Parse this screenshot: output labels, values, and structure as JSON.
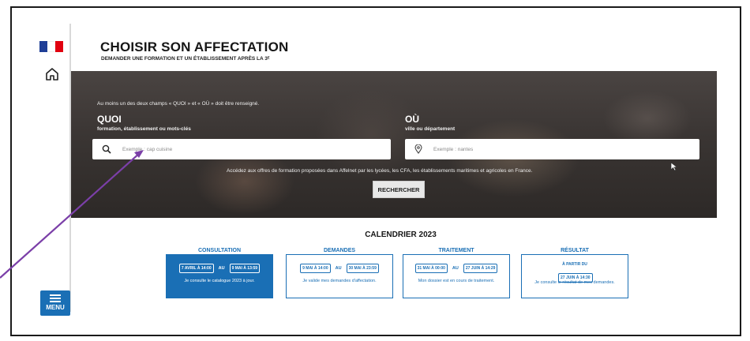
{
  "header": {
    "title": "CHOISIR SON AFFECTATION",
    "subtitle": "DEMANDER UNE FORMATION ET UN ÉTABLISSEMENT APRÈS LA 3ᴱ"
  },
  "sidebar": {
    "menu_label": "MENU"
  },
  "search": {
    "note": "Au moins un des deux champs « QUOI » et « OÙ » doit être renseigné.",
    "quoi_label": "QUOI",
    "quoi_sub": "formation, établissement ou mots-clés",
    "quoi_placeholder": "Exemple : cap cuisine",
    "ou_label": "OÙ",
    "ou_sub": "ville ou département",
    "ou_placeholder": "Exemple : nantes",
    "info": "Accédez aux offres de formation proposées dans Affelnet par les lycées, les CFA, les établissements maritimes et agricoles en France.",
    "button": "RECHERCHER"
  },
  "calendar": {
    "title": "CALENDRIER 2023",
    "consultation": {
      "head": "CONSULTATION",
      "from": "7 AVRIL À 14:00",
      "au": "AU",
      "to": "9 MAI À 13:59",
      "desc": "Je consulte le catalogue 2023 à jour."
    },
    "demandes": {
      "head": "DEMANDES",
      "from": "9 MAI À 14:00",
      "au": "AU",
      "to": "30 MAI À 23:59",
      "desc": "Je valide mes demandes d'affectation."
    },
    "traitement": {
      "head": "TRAITEMENT",
      "from": "31 MAI À 00:00",
      "au": "AU",
      "to": "27 JUIN À 14:29",
      "desc": "Mon dossier est en cours de traitement."
    },
    "resultat": {
      "head": "RÉSULTAT",
      "from_label": "À PARTIR DU",
      "date": "27 JUIN À 14:30",
      "desc": "Je consulte le résultat de mes demandes."
    }
  },
  "colors": {
    "accent": "#1a6fb5",
    "arrow": "#7b3fa8"
  }
}
